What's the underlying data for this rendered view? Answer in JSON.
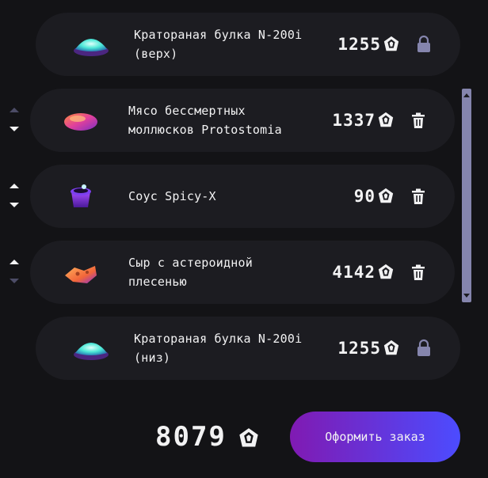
{
  "currency_icon": "crystal-currency-icon",
  "colors": {
    "background": "#131316",
    "card": "#1c1c21",
    "muted": "#8585ad",
    "accent_start": "#801ab2",
    "accent_end": "#4c4cff"
  },
  "constructor": {
    "top_bun": {
      "name": "Кратораная булка N-200i\n(верх)",
      "price": "1255",
      "action_icon": "lock-icon"
    },
    "fillings": [
      {
        "name": "Мясо бессмертных\nмоллюсков Protostomia",
        "price": "1337",
        "action_icon": "trash-icon"
      },
      {
        "name": "Соус Spicy-X",
        "price": "90",
        "action_icon": "trash-icon"
      },
      {
        "name": "Сыр с астероидной\nплесенью",
        "price": "4142",
        "action_icon": "trash-icon"
      }
    ],
    "bottom_bun": {
      "name": "Кратораная булка N-200i\n(низ)",
      "price": "1255",
      "action_icon": "lock-icon"
    }
  },
  "footer": {
    "total": "8079",
    "order_button_label": "Оформить заказ"
  }
}
